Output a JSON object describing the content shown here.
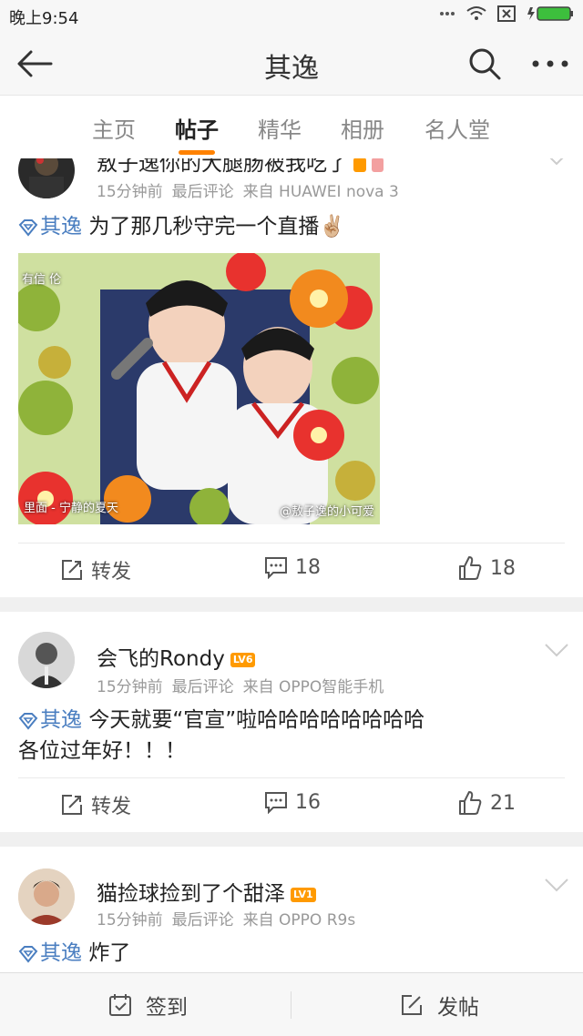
{
  "status_bar": {
    "time": "晚上9:54"
  },
  "nav": {
    "title": "其逸"
  },
  "tabs": [
    {
      "label": "主页",
      "active": false
    },
    {
      "label": "帖子",
      "active": true
    },
    {
      "label": "精华",
      "active": false
    },
    {
      "label": "相册",
      "active": false
    },
    {
      "label": "名人堂",
      "active": false
    }
  ],
  "posts": [
    {
      "username": "敖子逸你的大腿肠被我吃了",
      "time": "15分钟前",
      "last_comment": "最后评论",
      "source": "来自 HUAWEI nova 3",
      "topic": "其逸",
      "text": "为了那几秒守完一个直播",
      "emoji": "✌🏼",
      "image": {
        "caption": "里面 - 宁静的夏天",
        "watermark": "@敖子逸的小可爱",
        "corner_label": "有信 伦"
      },
      "actions": {
        "repost": "转发",
        "comments": "18",
        "likes": "18"
      }
    },
    {
      "username": "会飞的Rondy",
      "level": "LV6",
      "time": "15分钟前",
      "last_comment": "最后评论",
      "source": "来自 OPPO智能手机",
      "topic": "其逸",
      "text_line1": "今天就要“官宣”啦哈哈哈哈哈哈哈哈",
      "text_line2": "各位过年好！！！",
      "actions": {
        "repost": "转发",
        "comments": "16",
        "likes": "21"
      }
    },
    {
      "username": "猫捡球捡到了个甜泽",
      "level": "LV1",
      "time": "15分钟前",
      "last_comment": "最后评论",
      "source": "来自 OPPO R9s",
      "topic": "其逸",
      "text": "炸了"
    }
  ],
  "bottom_bar": {
    "checkin": "签到",
    "post": "发帖"
  },
  "colors": {
    "accent": "#ff8200",
    "topic": "#4a7ec0",
    "level_badge": "#ff9a00"
  }
}
